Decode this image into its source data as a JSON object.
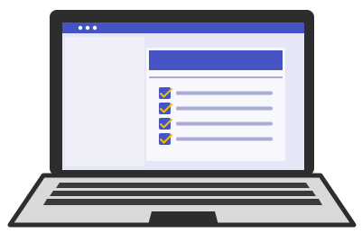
{
  "illustration": {
    "kind": "laptop-with-checklist",
    "window_dots": [
      "dot",
      "dot",
      "dot"
    ],
    "checklist": {
      "items": [
        {
          "checked": true
        },
        {
          "checked": true
        },
        {
          "checked": true
        },
        {
          "checked": true
        }
      ]
    },
    "colors": {
      "bezel": "#2d2d2d",
      "screen": "#e6e7f6",
      "title_bar": "#4553c4",
      "sidebar": "#eeeff9",
      "card": "#f7f7fc",
      "card_header": "#4553c4",
      "checkbox": "#4553c4",
      "check_mark": "#f2c000",
      "line": "#a9add6",
      "keyboard_deck": "#d9d9d9",
      "keyboard_keys": "#3a3a3a",
      "deck_outline": "#2d2d2d"
    }
  }
}
